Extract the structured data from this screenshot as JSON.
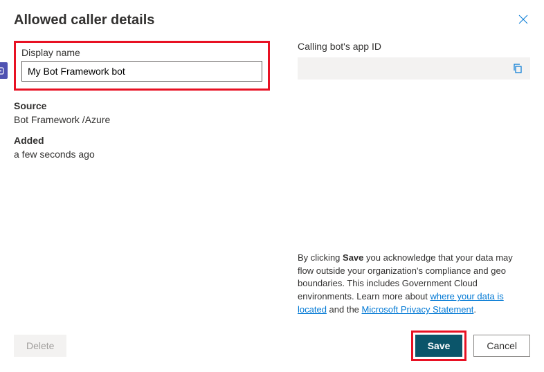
{
  "title": "Allowed caller details",
  "left": {
    "displayName": {
      "label": "Display name",
      "value": "My Bot Framework bot"
    },
    "source": {
      "label": "Source",
      "value": "Bot Framework /Azure"
    },
    "added": {
      "label": "Added",
      "value": "a few seconds ago"
    }
  },
  "right": {
    "appId": {
      "label": "Calling bot's app ID",
      "value": ""
    }
  },
  "disclaimer": {
    "preSave": "By clicking ",
    "saveWord": "Save",
    "body": " you acknowledge that your data may flow outside your organization's compliance and geo boundaries. This includes Government Cloud environments. Learn more about ",
    "link1": "where your data is located",
    "mid": " and the ",
    "link2": "Microsoft Privacy Statement",
    "period": "."
  },
  "buttons": {
    "delete": "Delete",
    "save": "Save",
    "cancel": "Cancel"
  }
}
